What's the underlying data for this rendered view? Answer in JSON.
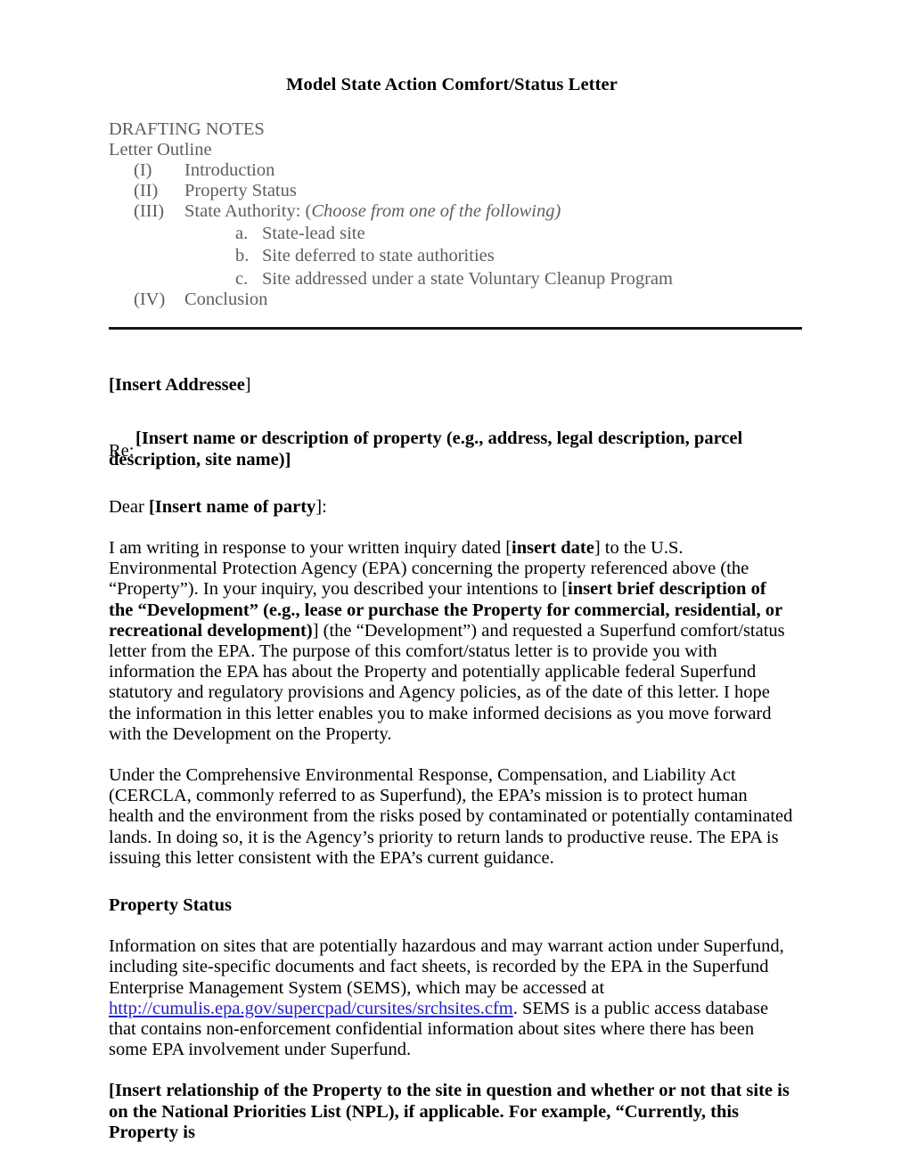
{
  "document": {
    "title": "Model State Action Comfort/Status Letter",
    "drafting_notes": {
      "heading": "DRAFTING NOTES",
      "subheading": "Letter Outline",
      "outline": [
        {
          "marker": "(I)",
          "label": "Introduction",
          "italic_suffix": ""
        },
        {
          "marker": "(II)",
          "label": "Property Status",
          "italic_suffix": ""
        },
        {
          "marker": "(III)",
          "label": "State Authority: (",
          "italic_suffix": "Choose from one of the following)"
        },
        {
          "marker": "(IV)",
          "label": "Conclusion",
          "italic_suffix": ""
        }
      ],
      "sub_outline": [
        {
          "marker": "a.",
          "label": "State-lead site"
        },
        {
          "marker": "b.",
          "label": "Site deferred to state authorities"
        },
        {
          "marker": "c.",
          "label": "Site addressed under a state Voluntary Cleanup Program"
        }
      ]
    },
    "letter": {
      "addressee_bold": "[Insert Addressee",
      "addressee_close": "]",
      "re_label": "Re:",
      "re_value_line1": "[Insert name or description of property (e.g., address, legal description, parcel",
      "re_value_line2": "description, site name)]",
      "salutation_prefix": "Dear ",
      "salutation_bold": "[Insert name of party",
      "salutation_suffix": "]:",
      "para1_a": "I am writing in response to your written inquiry dated [",
      "para1_b_bold": "insert date",
      "para1_c": "] to the U.S. Environmental Protection Agency (EPA) concerning the property referenced above (the “Property”). In your inquiry, you described your intentions to [",
      "para1_d_bold": "insert brief description of the “Development” (e.g., lease or purchase the Property for commercial, residential, or recreational development)",
      "para1_e": "] (the “Development”) and requested a Superfund comfort/status letter from the EPA. The purpose of this comfort/status letter is to provide you with information the EPA has about the Property and potentially applicable federal Superfund statutory and regulatory provisions and Agency policies, as of the date of this letter. I hope the information in this letter enables you to make informed decisions as you move forward with the Development on the Property.",
      "para2": "Under the Comprehensive Environmental Response, Compensation, and Liability Act (CERCLA, commonly referred to as Superfund), the EPA’s mission is to protect human health and the environment from the risks posed by contaminated or potentially contaminated lands. In doing so, it is the Agency’s priority to return lands to productive reuse. The EPA is issuing this letter consistent with the EPA’s current guidance.",
      "property_status_heading": "Property Status",
      "para3_a": "Information on sites that are potentially hazardous and may warrant action under Superfund, including site-specific documents and fact sheets, is recorded by the EPA in the Superfund Enterprise Management System (SEMS), which may be accessed at ",
      "para3_link": "http://cumulis.epa.gov/supercpad/cursites/srchsites.cfm",
      "para3_b": ". SEMS is a public access database that contains non-enforcement confidential information about sites where there has been some EPA involvement under Superfund.",
      "para4_bold": "[Insert relationship of the Property to the site in question and whether or not that site is on the National Priorities List (NPL), if applicable. For example, “Currently, this Property is"
    },
    "colors": {
      "notes_gray": "#5e5e62",
      "link_blue": "#2222cc",
      "rule_dark": "#16161e",
      "body_black": "#000000"
    }
  }
}
